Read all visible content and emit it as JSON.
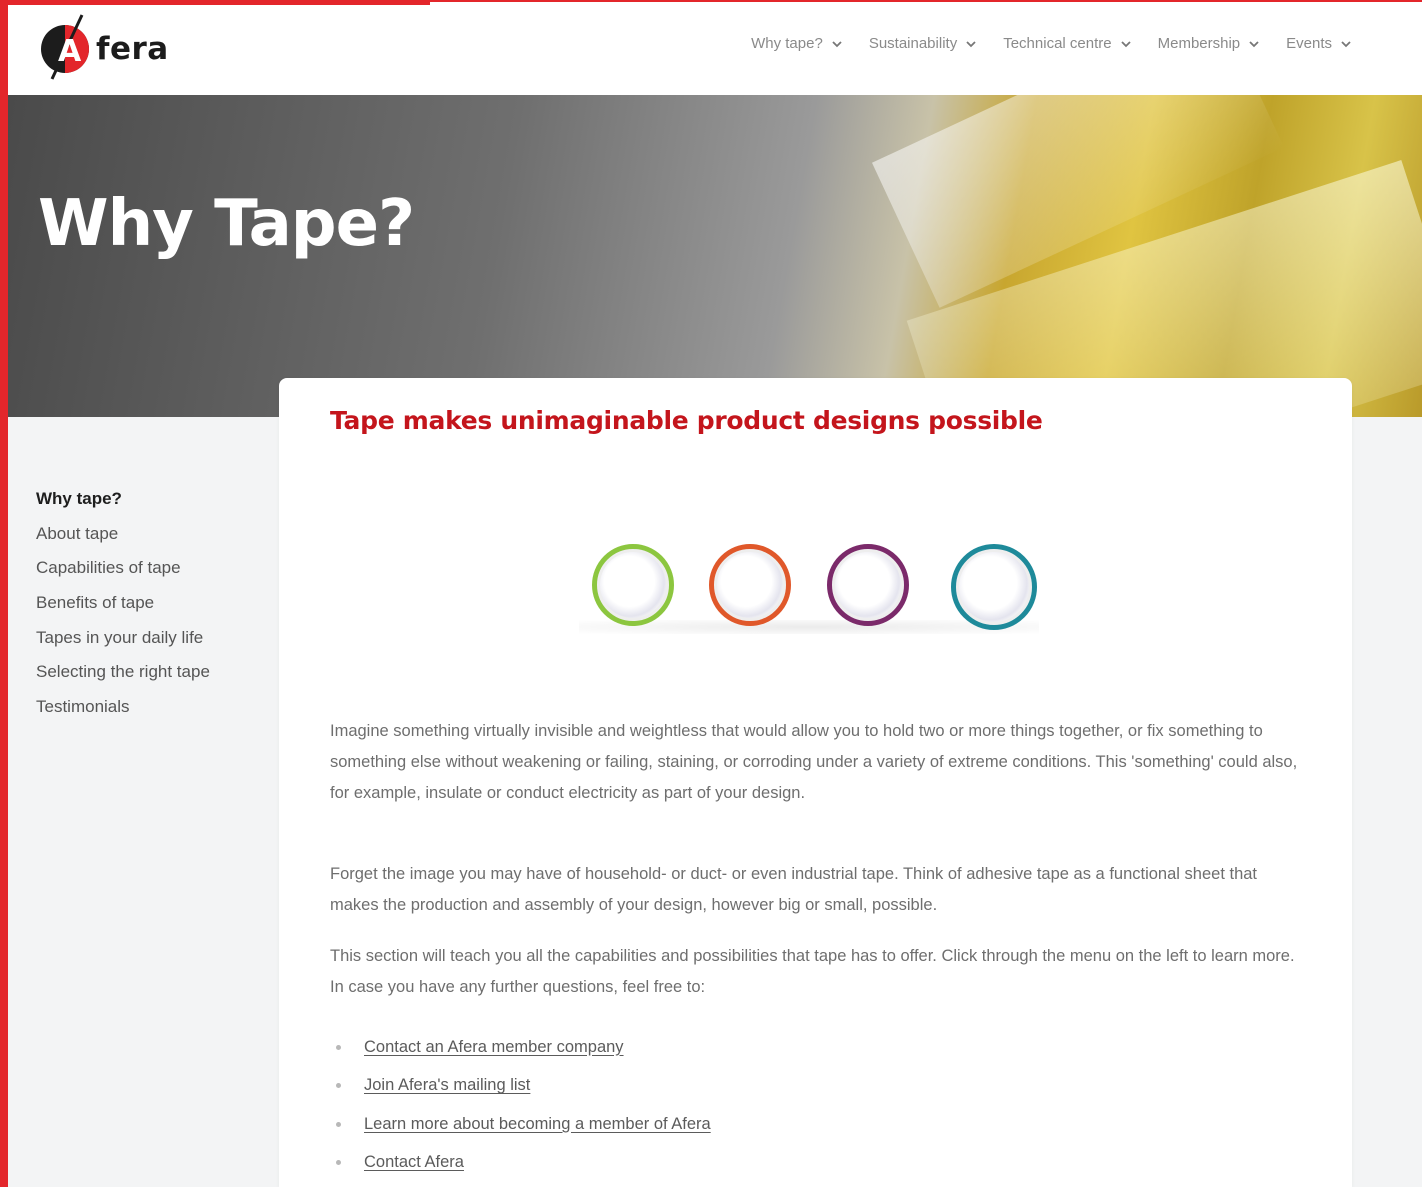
{
  "brand": {
    "name": "fera",
    "logo_mark": "A",
    "accent_color": "#e3262b",
    "title_color": "#c4151c"
  },
  "nav": {
    "items": [
      {
        "label": "Why tape?",
        "icon": "chevron-down-icon"
      },
      {
        "label": "Sustainability",
        "icon": "chevron-down-icon"
      },
      {
        "label": "Technical centre",
        "icon": "chevron-down-icon"
      },
      {
        "label": "Membership",
        "icon": "chevron-down-icon"
      },
      {
        "label": "Events",
        "icon": "chevron-down-icon"
      }
    ]
  },
  "hero": {
    "title": "Why Tape?"
  },
  "sidebar": {
    "items": [
      {
        "label": "Why tape?",
        "active": true
      },
      {
        "label": "About tape"
      },
      {
        "label": "Capabilities of tape"
      },
      {
        "label": "Benefits of tape"
      },
      {
        "label": "Tapes in your daily life"
      },
      {
        "label": "Selecting the right tape"
      },
      {
        "label": "Testimonials"
      }
    ]
  },
  "content": {
    "title": "Tape makes unimaginable product designs possible",
    "ring_colors": [
      "#8cc63f",
      "#e0582a",
      "#7b2a6a",
      "#1e8a9a"
    ],
    "paragraphs": [
      "Imagine something virtually invisible and weightless that would allow you to hold two or more things together, or fix something to something else without weakening or failing, staining, or corroding under a variety of extreme conditions. This 'something' could also, for example, insulate or conduct electricity as part of your design.",
      "Forget the image you may have of household- or duct- or even industrial tape. Think of adhesive tape as a functional sheet that makes the production and assembly of your design, however big or small, possible.",
      "This section will teach you all the capabilities and possibilities that tape has to offer. Click through the menu on the left to learn more. In case you have any further questions, feel free to:"
    ],
    "links": [
      "Contact an Afera member company",
      "Join Afera's mailing list",
      "Learn more about becoming a member of Afera",
      "Contact Afera "
    ]
  }
}
